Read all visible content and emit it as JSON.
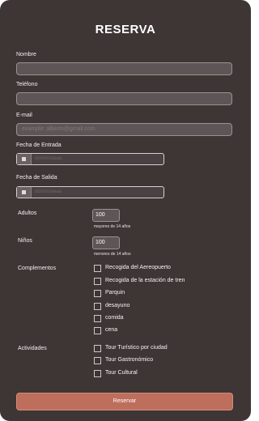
{
  "form": {
    "title": "RESERVA",
    "nombre": {
      "label": "Nombre",
      "value": "",
      "placeholder": ""
    },
    "telefono": {
      "label": "Teléfono",
      "value": "",
      "placeholder": ""
    },
    "email": {
      "label": "E-mail",
      "placeholder": "example: alberto@gmail.com"
    },
    "entrada": {
      "label": "Fecha de Entrada",
      "placeholder": "dd/mm/aaaa"
    },
    "salida": {
      "label": "Fecha de Salida",
      "placeholder": "dd/mm/aaaa"
    },
    "adultos": {
      "label": "Adultos",
      "value": "100",
      "hint": "mayores de 14 años"
    },
    "ninos": {
      "label": "Niños",
      "value": "100",
      "hint": "menores de 14 años"
    },
    "complementos": {
      "label": "Complementos",
      "options": [
        "Recogida del Aereopuerto",
        "Recogida de la estación de tren",
        "Parquin",
        "desayuno",
        "comida",
        "cena"
      ]
    },
    "actividades": {
      "label": "Actividades",
      "options": [
        "Tour Turístico por ciudad",
        "Tour Gastronómico",
        "Tour Cultural"
      ]
    },
    "submit_label": "Reservar"
  },
  "colors": {
    "card_background": "#3e3535",
    "input_background": "#5e5656",
    "button": "#bd6e5c"
  },
  "icons": {
    "date_picker": "calendar-icon",
    "checkbox": "checkbox-icon"
  }
}
